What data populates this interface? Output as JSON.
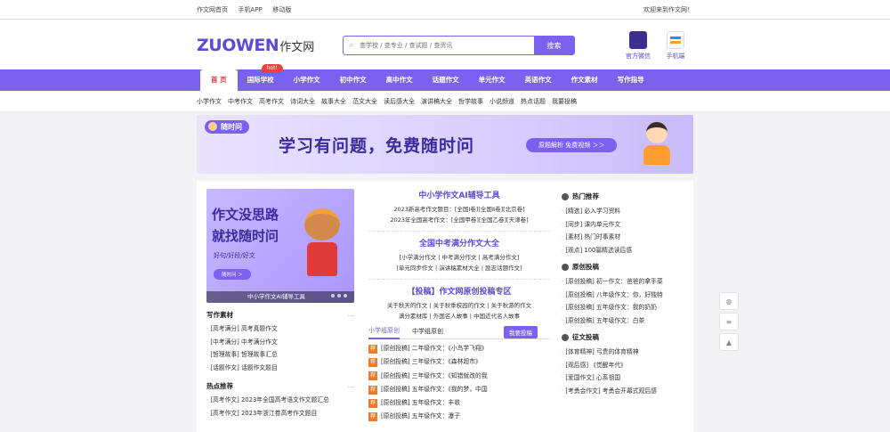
{
  "topbar": {
    "links": [
      "作文网首页",
      "手机APP",
      "移动版"
    ],
    "welcome": "欢迎来到作文网！"
  },
  "header": {
    "logo_en": "ZUOWEN",
    "logo_cn": "作文网",
    "search_placeholder": "查学校 / 查专业 / 查试题 / 查资讯",
    "search_button": "搜索",
    "qr1_label": "官方微信",
    "qr2_label": "手机端"
  },
  "nav": {
    "items": [
      "首 页",
      "国际学校",
      "小学作文",
      "初中作文",
      "高中作文",
      "话题作文",
      "单元作文",
      "英语作文",
      "作文素材",
      "写作指导"
    ],
    "hot_badge": "hot!"
  },
  "subnav": [
    "小学作文",
    "中考作文",
    "高考作文",
    "诗词大全",
    "故事大全",
    "范文大全",
    "读后感大全",
    "演讲稿大全",
    "哲学故事",
    "小说频道",
    "热点话题",
    "我要投稿"
  ],
  "banner": {
    "badge": "随时问",
    "headline": "学习有问题，免费随时问",
    "cta": "原题解析 免费视频 ＞＞"
  },
  "left": {
    "promo_line1": "作文没思路",
    "promo_line2": "就找随时问",
    "promo_line3": "好句/好段/好文",
    "promo_btn": "随时问 ＞",
    "promo_caption": "中小学作文AI辅导工具",
    "sec1_title": "写作素材",
    "sec1_more": "…",
    "sec1_items": [
      "[高考满分] 高考真题作文",
      "[中考满分] 中考满分作文",
      "[哲理故事] 哲理故事汇总",
      "[话题作文] 话题作文题目"
    ],
    "sec2_title": "热点推荐",
    "sec2_more": "…",
    "sec2_items": [
      "[高考作文] 2023年全国高考语文作文题汇总",
      "[高考作文] 2023年浙江卷高考作文题目"
    ]
  },
  "middle": {
    "block1_title": "中小学作文AI辅导工具",
    "block1_lines": [
      "2023新高考作文题目：[全国Ⅰ卷][全国Ⅱ卷][北京卷]",
      "2023年全国高考作文：[全国甲卷][全国乙卷][天津卷]"
    ],
    "block2_title": "全国中考满分作文大全",
    "block2_lines": [
      "[小学满分作文 | 中考满分作文 | 高考满分作文]",
      "[单元同步作文 | 演讲稿素材大全 | 励志话题作文]"
    ],
    "block3_title": "【投稿】作文网原创投稿专区",
    "block3_lines": [
      "关于秋天的作文 | 关于秋季校园的作文 | 关于秋游的作文",
      "满分素材库 | 外国名人故事 | 中国近代名人故事"
    ],
    "tab1": "小学组原创",
    "tab2": "中学组原创",
    "post_button": "我要投稿",
    "tag": "荐",
    "items": [
      "[原创投稿] 二年级作文：《小鸟学飞翔》",
      "[原创投稿] 三年级作文：《森林超市》",
      "[原创投稿] 三年级作文：《知错就改的我",
      "[原创投稿] 五年级作文：《我的梦，中国",
      "[原创投稿] 五年级作文：丰收",
      "[原创投稿] 五年级作文：瀑子"
    ]
  },
  "right": {
    "sec1_title": "热门推荐",
    "sec1_items": [
      "[精选] 必入学习资料",
      "[同步] 课内单元作文",
      "[素材] 热门时事素材",
      "[观点] 100篇精选读后感"
    ],
    "sec2_title": "原创投稿",
    "sec2_items": [
      "[原创投稿] 初一作文：爸爸的拿手菜",
      "[原创投稿] 八年级作文：你，好独特",
      "[原创投稿] 五年级作文：我的奶奶",
      "[原创投稿] 五年级作文：白茶"
    ],
    "sec3_title": "征文投稿",
    "sec3_items": [
      "[体育精神] 弓贵的体育精神",
      "[观后感] 《觉醒年代》",
      "[爱国作文] 心系祖国",
      "[考勇会作文] 考勇会开幕式观后感"
    ]
  }
}
